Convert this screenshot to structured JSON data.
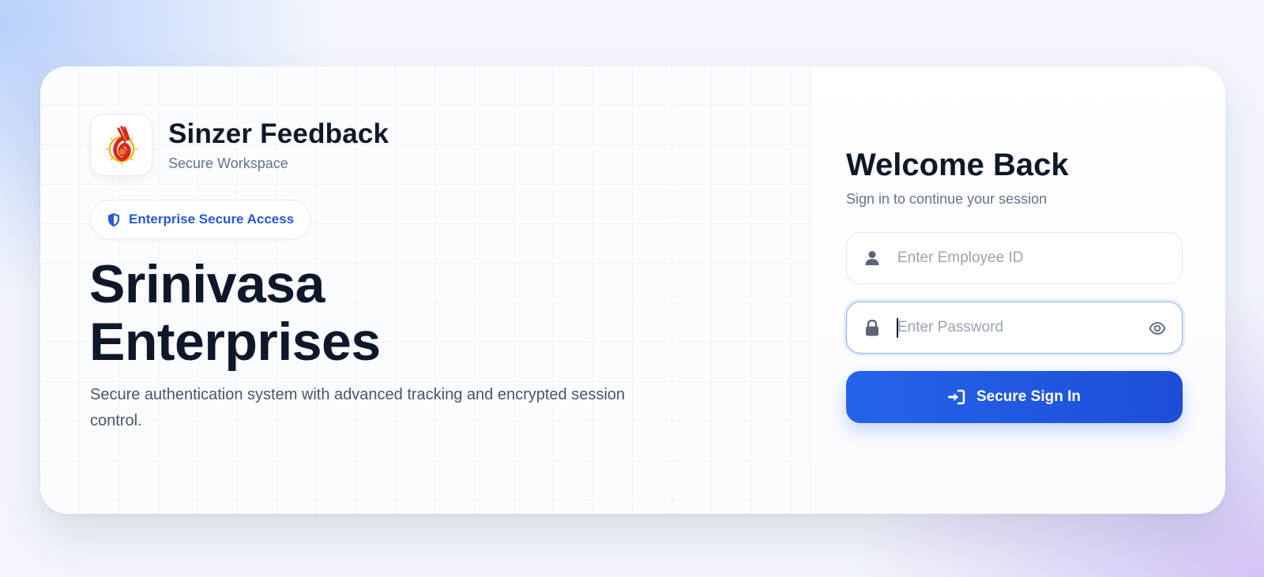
{
  "brand": {
    "name": "Sinzer Feedback",
    "subtitle": "Secure Workspace"
  },
  "badge": {
    "label": "Enterprise Secure Access",
    "icon": "shield-icon"
  },
  "hero": {
    "line1": "Srinivasa",
    "line2": "Enterprises",
    "description": "Secure authentication system with advanced tracking and encrypted session control."
  },
  "login": {
    "title": "Welcome Back",
    "subtitle": "Sign in to continue your session",
    "employee_placeholder": "Enter Employee ID",
    "employee_value": "",
    "password_placeholder": "Enter Password",
    "password_value": "",
    "submit_label": "Secure Sign In"
  },
  "colors": {
    "accent": "#2563eb",
    "badge_text": "#2457d6",
    "heading": "#0f172a"
  }
}
